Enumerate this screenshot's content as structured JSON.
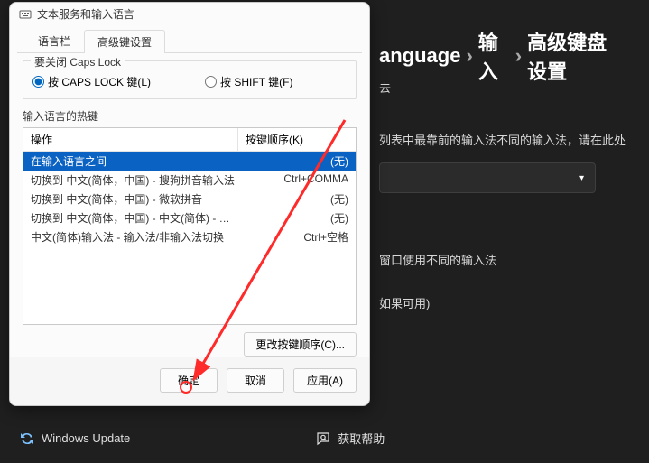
{
  "breadcrumb": {
    "a": "anguage",
    "b": "输入",
    "c": "高级键盘设置"
  },
  "bg": {
    "t1": "去",
    "t2": "列表中最靠前的输入法不同的输入法，请在此处",
    "t3": "窗口使用不同的输入法",
    "t4": "如果可用)"
  },
  "bottom": {
    "wu": "Windows Update",
    "help": "获取帮助"
  },
  "dialog": {
    "title": "文本服务和输入语言",
    "tabs": {
      "a": "语言栏",
      "b": "高级键设置"
    },
    "caps_group": "要关闭 Caps Lock",
    "radio_caps": "按 CAPS LOCK 键(L)",
    "radio_shift": "按 SHIFT 键(F)",
    "hotkeys_label": "输入语言的热键",
    "col_action": "操作",
    "col_key": "按键顺序(K)",
    "rows": [
      {
        "action": "在输入语言之间",
        "key": "(无)"
      },
      {
        "action": "切换到 中文(简体，中国) - 搜狗拼音输入法",
        "key": "Ctrl+COMMA"
      },
      {
        "action": "切换到 中文(简体，中国) - 微软拼音",
        "key": "(无)"
      },
      {
        "action": "切换到 中文(简体，中国) - 中文(简体) - 手心输入法",
        "key": "(无)"
      },
      {
        "action": "中文(简体)输入法 - 输入法/非输入法切换",
        "key": "Ctrl+空格"
      }
    ],
    "change": "更改按键顺序(C)...",
    "ok": "确定",
    "cancel": "取消",
    "apply": "应用(A)"
  }
}
